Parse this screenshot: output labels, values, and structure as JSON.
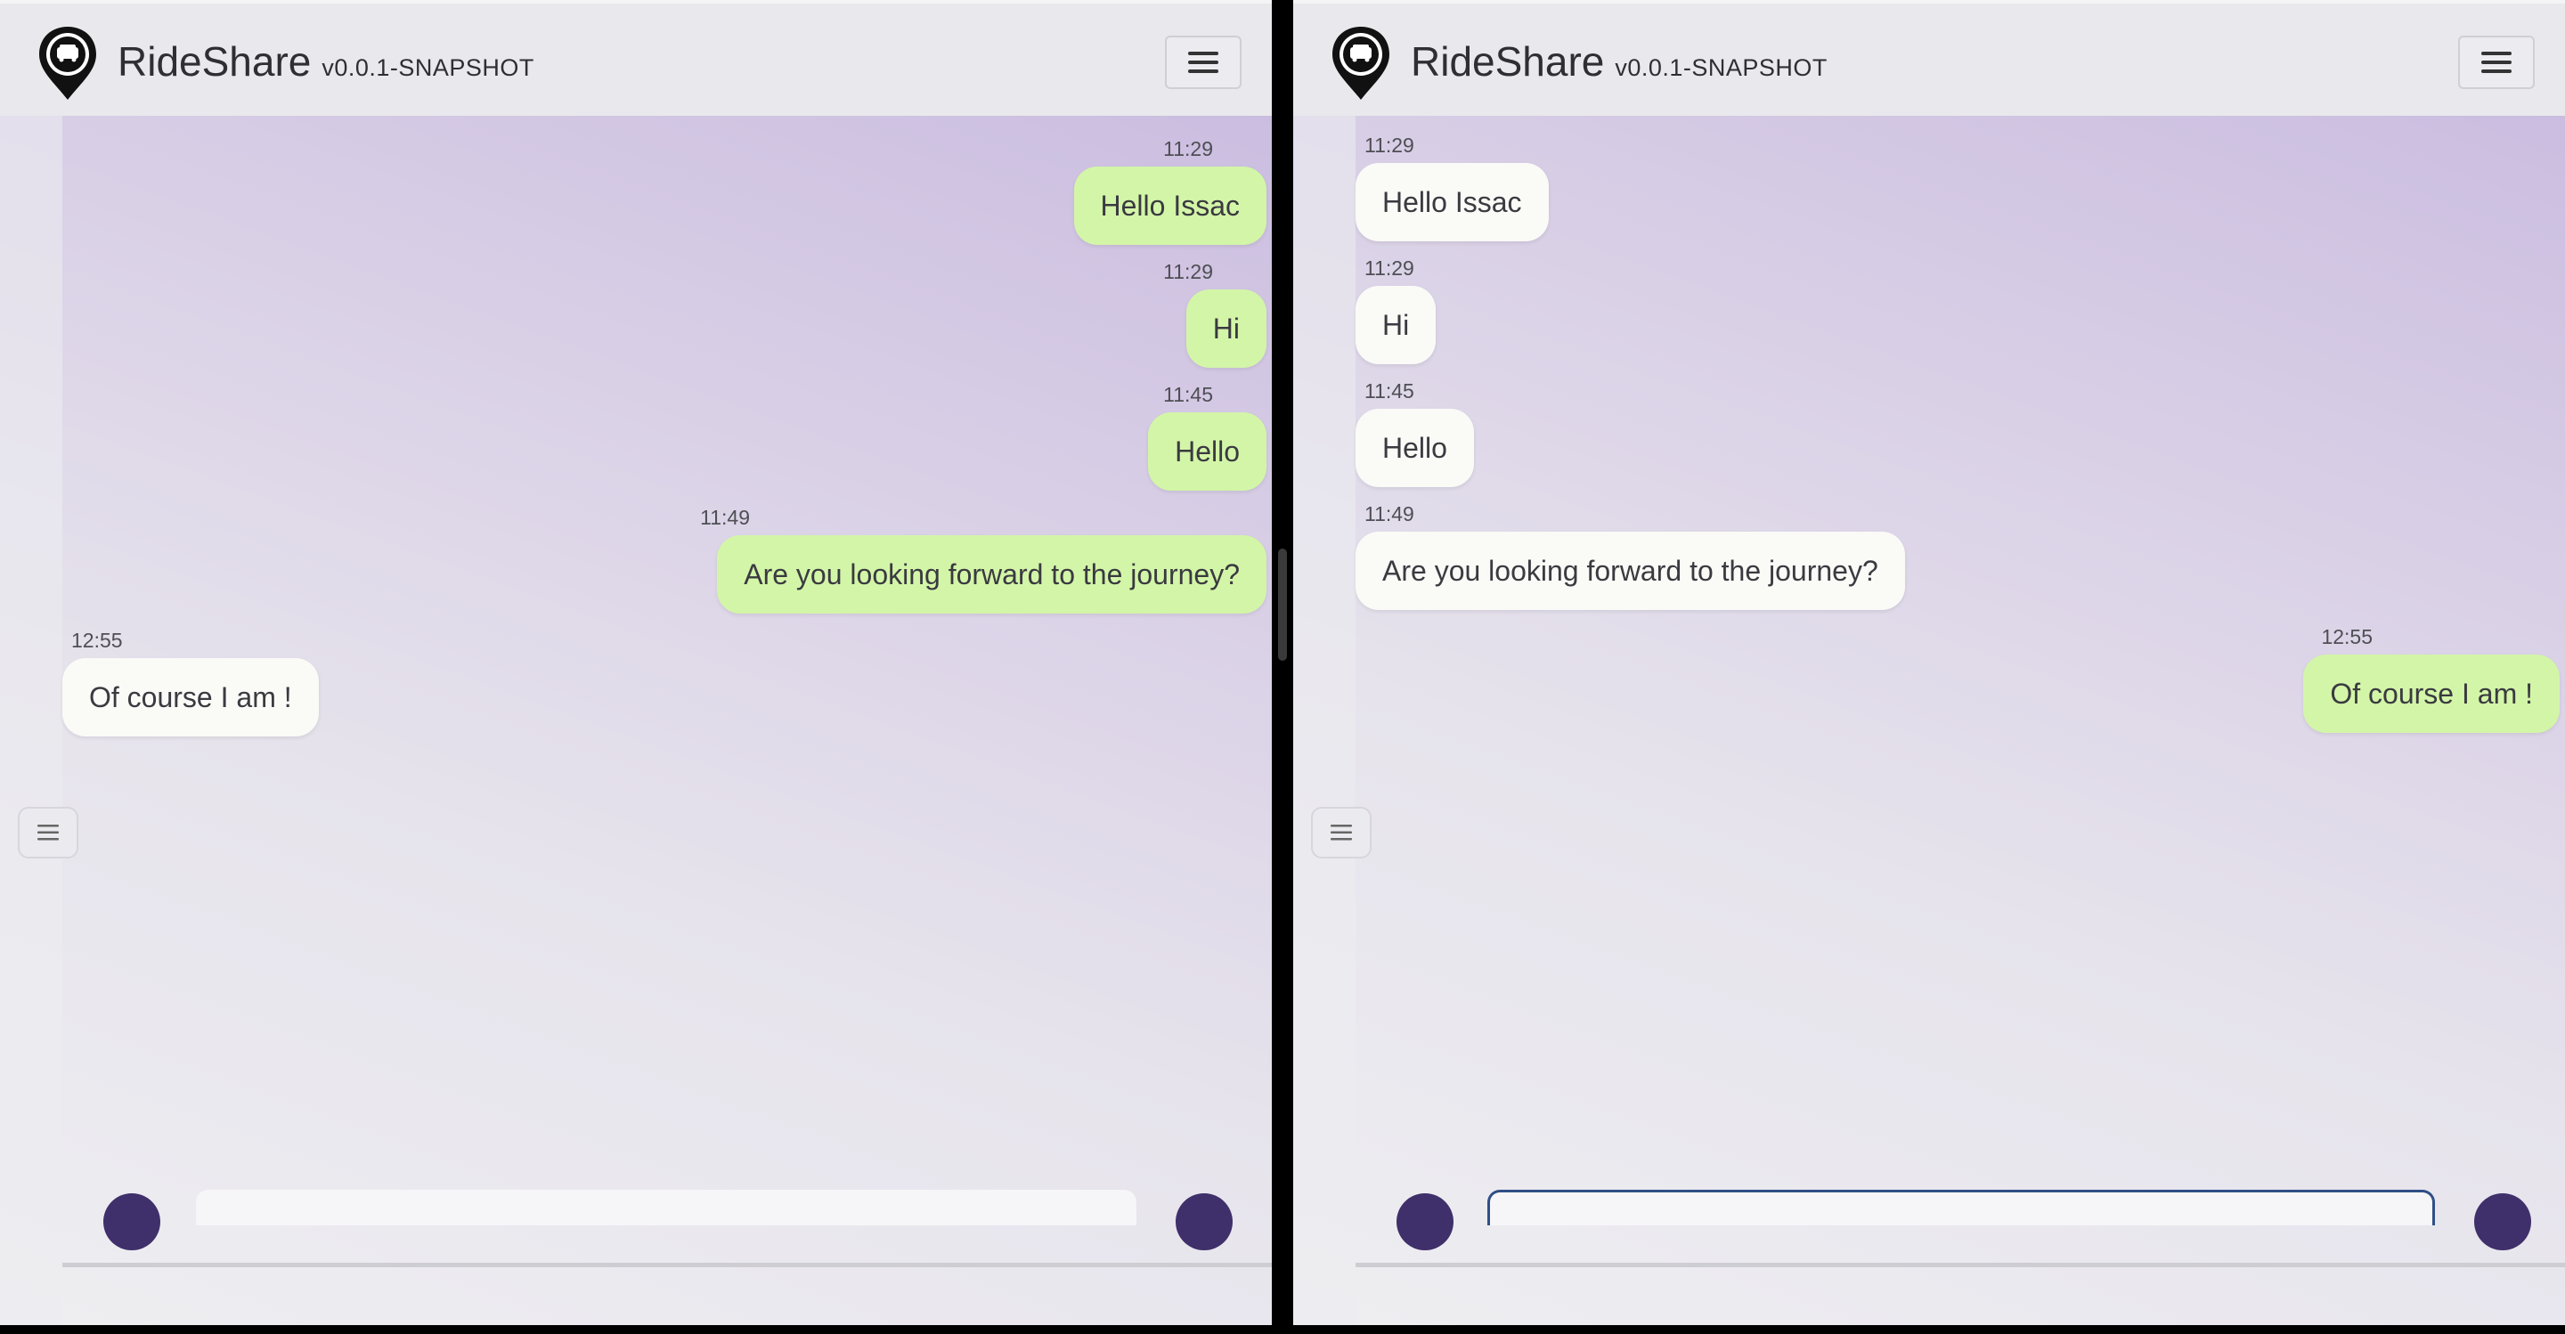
{
  "panes": {
    "left": {
      "app": {
        "name": "RideShare",
        "version": "v0.0.1-SNAPSHOT"
      },
      "messages": [
        {
          "time": "11:29",
          "text": "Hello Issac"
        },
        {
          "time": "11:29",
          "text": "Hi"
        },
        {
          "time": "11:45",
          "text": "Hello"
        },
        {
          "time": "11:49",
          "text": "Are you looking forward to the journey?"
        },
        {
          "time": "12:55",
          "text": "Of course I am !"
        }
      ]
    },
    "right": {
      "app": {
        "name": "RideShare",
        "version": "v0.0.1-SNAPSHOT"
      },
      "messages": [
        {
          "time": "11:29",
          "text": "Hello Issac"
        },
        {
          "time": "11:29",
          "text": "Hi"
        },
        {
          "time": "11:45",
          "text": "Hello"
        },
        {
          "time": "11:49",
          "text": "Are you looking forward to the journey?"
        },
        {
          "time": "12:55",
          "text": "Of course I am !"
        }
      ]
    }
  },
  "icons": {
    "logo": "rideshare-map-pin-car-logo",
    "menu": "hamburger-menu-icon",
    "drawer": "list-icon"
  },
  "colors": {
    "sent_bubble": "#d3f5a8",
    "received_bubble": "#fafaf7",
    "header_bg": "#e9e9ed",
    "chat_bg_top": "#cbbde0",
    "chat_bg_bottom": "#eeeef1",
    "accent": "#3f2f6a"
  }
}
